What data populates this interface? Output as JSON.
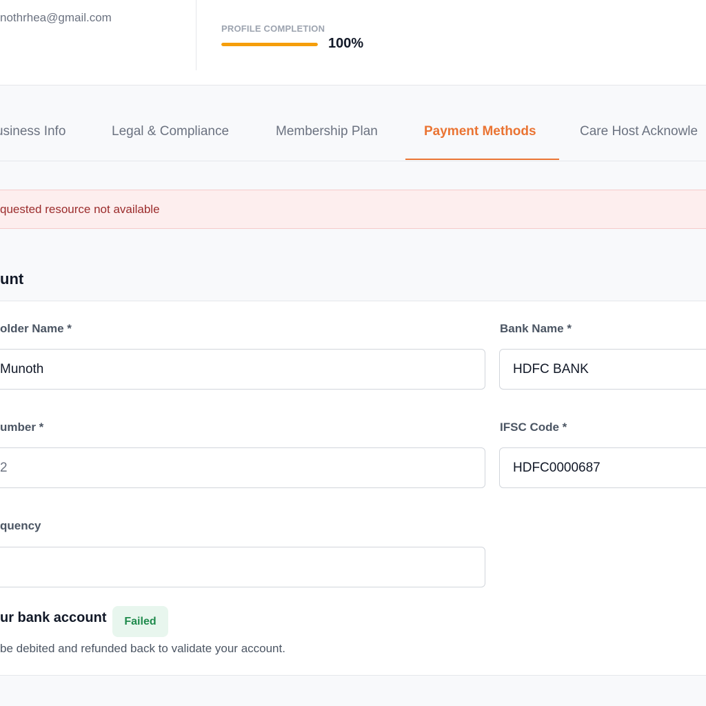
{
  "header": {
    "email": "nothrhea@gmail.com",
    "profile_completion_label": "PROFILE COMPLETION",
    "profile_completion_value": "100%",
    "profile_completion_fraction": 1.0
  },
  "tabs": [
    {
      "label": "usiness Info",
      "active": false
    },
    {
      "label": "Legal & Compliance",
      "active": false
    },
    {
      "label": "Membership Plan",
      "active": false
    },
    {
      "label": "Payment Methods",
      "active": true
    },
    {
      "label": "Care Host Acknowle",
      "active": false
    }
  ],
  "alert": {
    "text": "quested resource not available"
  },
  "section": {
    "title": "unt"
  },
  "form": {
    "holder_name": {
      "label": "older Name *",
      "value": "Munoth"
    },
    "bank_name": {
      "label": "Bank Name *",
      "value": "HDFC BANK"
    },
    "account_number": {
      "label": "umber *",
      "value": "2"
    },
    "ifsc_code": {
      "label": "IFSC Code *",
      "value": "HDFC0000687"
    },
    "frequency": {
      "label": "quency",
      "value": ""
    }
  },
  "verify": {
    "title": "ur bank account",
    "status": "Failed",
    "description": "be debited and refunded back to validate your account."
  },
  "colors": {
    "accent": "#ea7433",
    "progress": "#f59e0b",
    "alert_bg": "#fdeeee",
    "alert_text": "#9b2c2c",
    "badge_bg": "#e8f6ee",
    "badge_text": "#1f8a4c"
  }
}
